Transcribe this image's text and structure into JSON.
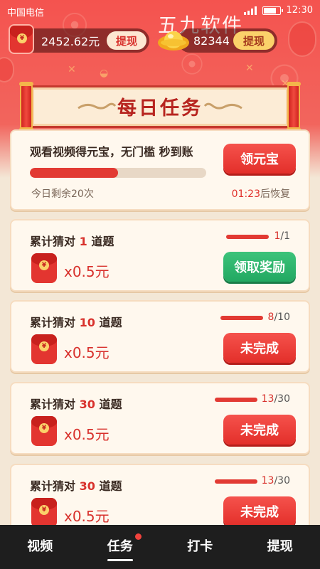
{
  "status_bar": {
    "carrier": "中国电信",
    "time": "12:30"
  },
  "watermark": "五九软件",
  "balance": {
    "cash": "2452.62元",
    "cash_button": "提现",
    "gold": "82344",
    "gold_button": "提现"
  },
  "banner_title": "每日任务",
  "video_task": {
    "title": "观看视频得元宝，无门槛 秒到账",
    "button": "领元宝",
    "progress_fraction": 0.5,
    "remaining": "今日剩余20次",
    "countdown": "01:23",
    "recover_suffix": "后恢复"
  },
  "tasks": [
    {
      "prefix": "累计猜对",
      "count": "1",
      "suffix": "道题",
      "progress_done": "1",
      "progress_total": "/1",
      "reward": "x0.5元",
      "button": "领取奖励",
      "completed": true
    },
    {
      "prefix": "累计猜对",
      "count": "10",
      "suffix": "道题",
      "progress_done": "8",
      "progress_total": "/10",
      "reward": "x0.5元",
      "button": "未完成",
      "completed": false
    },
    {
      "prefix": "累计猜对",
      "count": "30",
      "suffix": "道题",
      "progress_done": "13",
      "progress_total": "/30",
      "reward": "x0.5元",
      "button": "未完成",
      "completed": false
    },
    {
      "prefix": "累计猜对",
      "count": "30",
      "suffix": "道题",
      "progress_done": "13",
      "progress_total": "/30",
      "reward": "x0.5元",
      "button": "未完成",
      "completed": false
    }
  ],
  "nav": {
    "video": "视频",
    "task": "任务",
    "checkin": "打卡",
    "withdraw": "提现"
  },
  "colors": {
    "primary_red": "#e32f2a",
    "success_green": "#22a862",
    "background": "#f3e7d6"
  }
}
